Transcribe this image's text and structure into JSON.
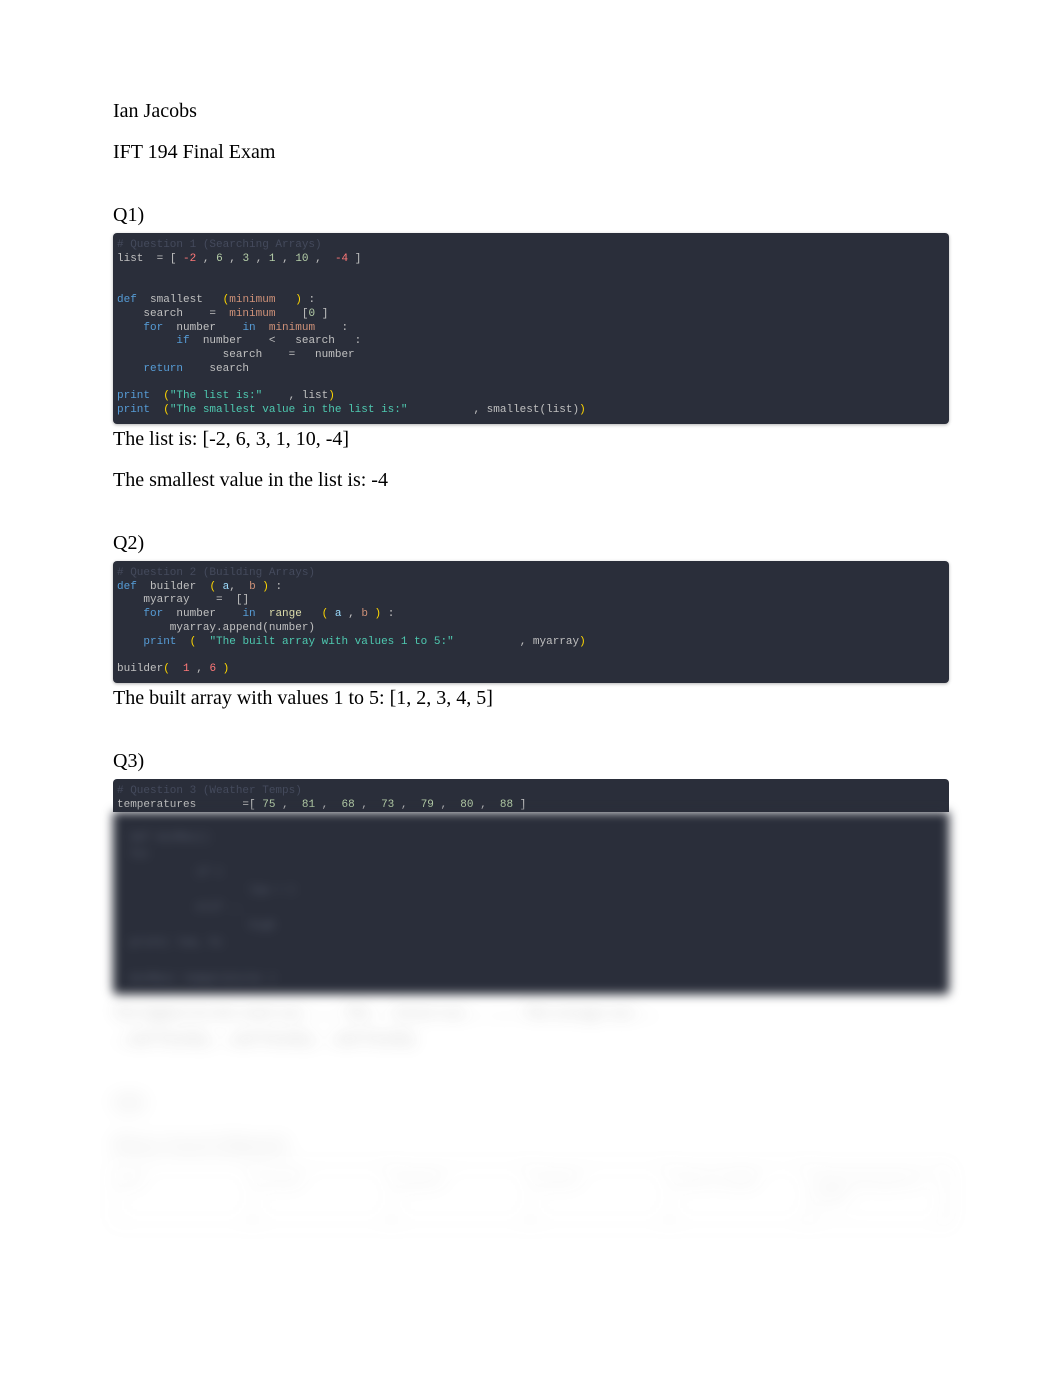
{
  "author": "Ian Jacobs",
  "title": "IFT 194 Final Exam",
  "q1": {
    "label": "Q1)",
    "comment": "# Question 1 (Searching Arrays)",
    "line1": {
      "pre": "list  ",
      "eq": "=",
      "open": " [ ",
      "vals": "-2 , 6 , 3 , 1 , 10 ,  -4",
      "close": " ]"
    },
    "code_lines": [
      "def  smallest   (minimum   ) :",
      "    search    =  minimum    [0 ]",
      "    for  number    in  minimum    :",
      "         if  number    <   search   :",
      "                search    =   number",
      "    return    search",
      "",
      "print  (\"The list is:\"    , list)",
      "print  (\"The smallest value in the list is:\"          , smallest(list))"
    ],
    "output1": "The list is: [-2, 6, 3, 1, 10, -4]",
    "output2": "The smallest value in the list is: -4"
  },
  "q2": {
    "label": "Q2)",
    "comment": "# Question 2 (Building Arrays)",
    "code_lines": [
      "def  builder  ( a,  b ) :",
      "    myarray    =  []",
      "    for  number    in  range   ( a , b ) :",
      "        myarray.append(number)",
      "    print  (  \"The built array with values 1 to 5:\"          , myarray)",
      "",
      "builder(  1 , 6 )"
    ],
    "output": "The built array with values 1 to 5: [1, 2, 3, 4, 5]"
  },
  "q3": {
    "label": "Q3)",
    "comment": "# Question 3 (Weather Temps)",
    "line1_pre": "temperatures       ",
    "line1_eq": "=",
    "line1_vals": "[ 75 ,  81 ,  68 ,  73 ,  79 ,  80 ,  88 ]",
    "blurred_lines": [
      "def minMax()",
      "for ",
      "     if t",
      "         low = t",
      "     elif ….",
      "         high",
      "print( low, hi",
      "minMax( temperatures )"
    ],
    "blurred_output_l1": "The highest for the week was: ……  The … lowest was … ……  The average was: …",
    "blurred_output_l2": "…and Tuesday,  …and Tuesday,  …and Tuesday"
  },
  "q4": {
    "label": "Q4)",
    "subheading": "Binary Search (Manual)",
    "table_headers": [
      "Step",
      "Formula",
      "Equation",
      "Solution",
      "Value of middle",
      "Target (less/greater or equal)"
    ]
  }
}
